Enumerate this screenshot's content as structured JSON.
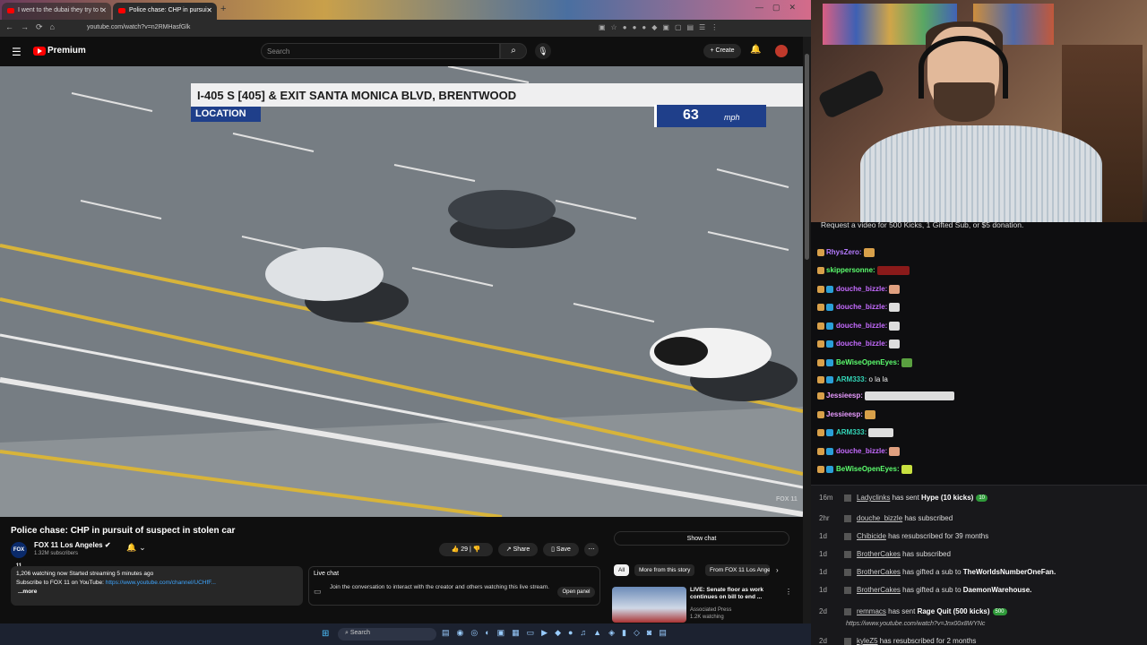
{
  "browser": {
    "tabs": [
      {
        "label": "I went to the dubai they try to t"
      },
      {
        "label": "Police chase: CHP in pursui"
      }
    ],
    "url": "youtube.com/watch?v=n2RMHasfGlk"
  },
  "youtube": {
    "logo_text": "Premium",
    "search_placeholder": "Search",
    "create_label": "Create"
  },
  "video": {
    "location_text": "I-405 S [405] & EXIT SANTA MONICA BLVD, BRENTWOOD",
    "location_label": "LOCATION",
    "speed_value": "63",
    "speed_unit": "mph",
    "watermark": "FOX 11",
    "title": "Police chase: CHP in pursuit of suspect in stolen car",
    "channel_logo": "FOX 11",
    "channel_name": "FOX 11 Los Angeles",
    "subscribers": "1.32M subscribers",
    "likes": "29",
    "share_label": "Share",
    "save_label": "Save",
    "description_line1": "1,206 watching now  Started streaming 5 minutes ago",
    "description_line2": "Subscribe to FOX 11 on YouTube: ",
    "description_link": "https://www.youtube.com/channel/UCHfF...",
    "description_more": "...more"
  },
  "livechat": {
    "title": "Live chat",
    "text": "Join the conversation to interact with the creator and others watching this live stream.",
    "open_panel": "Open panel"
  },
  "sidebar": {
    "show_chat": "Show chat",
    "chips": [
      "All",
      "More from this story",
      "From FOX 11 Los Angeles"
    ],
    "related": {
      "title": "LIVE: Senate floor as work continues on bill to end ...",
      "channel": "Associated Press",
      "views": "1.2K watching"
    }
  },
  "taskbar": {
    "search_label": "Search"
  },
  "chat": {
    "header": "Request a video for 500 Kicks, 1 Gifted Sub, or $5 donation.",
    "messages": [
      {
        "name": "RhysZero:",
        "text": "",
        "color": "#b57bff"
      },
      {
        "name": "skippersonne:",
        "text": "",
        "color": "#5cff6e"
      },
      {
        "name": "douche_bizzle:",
        "text": "",
        "color": "#c56bff"
      },
      {
        "name": "douche_bizzle:",
        "text": "",
        "color": "#c56bff"
      },
      {
        "name": "douche_bizzle:",
        "text": "",
        "color": "#c56bff"
      },
      {
        "name": "douche_bizzle:",
        "text": "",
        "color": "#c56bff"
      },
      {
        "name": "BeWiseOpenEyes:",
        "text": "",
        "color": "#5cff6e"
      },
      {
        "name": "ARM333:",
        "text": "o la la",
        "color": "#33d6b8"
      },
      {
        "name": "Jessieesp:",
        "text": "",
        "color": "#e89bff"
      },
      {
        "name": "Jessieesp:",
        "text": "",
        "color": "#e89bff"
      },
      {
        "name": "ARM333:",
        "text": "",
        "color": "#33d6b8"
      },
      {
        "name": "douche_bizzle:",
        "text": "",
        "color": "#c56bff"
      },
      {
        "name": "BeWiseOpenEyes:",
        "text": "",
        "color": "#5cff6e"
      }
    ],
    "events": [
      {
        "time": "16m",
        "user": "Ladyclinks",
        "text": " has sent ",
        "bold": "Hype (10 kicks)",
        "tag": "10"
      },
      {
        "time": "2hr",
        "user": "douche_bizzle",
        "text": " has subscribed",
        "bold": "",
        "tag": ""
      },
      {
        "time": "1d",
        "user": "Chibicide",
        "text": " has resubscribed for 39 months",
        "bold": "",
        "tag": ""
      },
      {
        "time": "1d",
        "user": "BrotherCakes",
        "text": " has subscribed",
        "bold": "",
        "tag": ""
      },
      {
        "time": "1d",
        "user": "BrotherCakes",
        "text": " has gifted a sub to ",
        "bold": "TheWorldsNumberOneFan.",
        "tag": ""
      },
      {
        "time": "1d",
        "user": "BrotherCakes",
        "text": " has gifted a sub to ",
        "bold": "DaemonWarehouse.",
        "tag": ""
      },
      {
        "time": "2d",
        "user": "remmacs",
        "text": " has sent ",
        "bold": "Rage Quit (500 kicks)",
        "tag": "500"
      },
      {
        "time": "2d",
        "user": "kyleZ5",
        "text": " has resubscribed for 2 months",
        "bold": "",
        "tag": ""
      }
    ],
    "event_link": "https://www.youtube.com/watch?v=Jnx00x8WYNc"
  }
}
